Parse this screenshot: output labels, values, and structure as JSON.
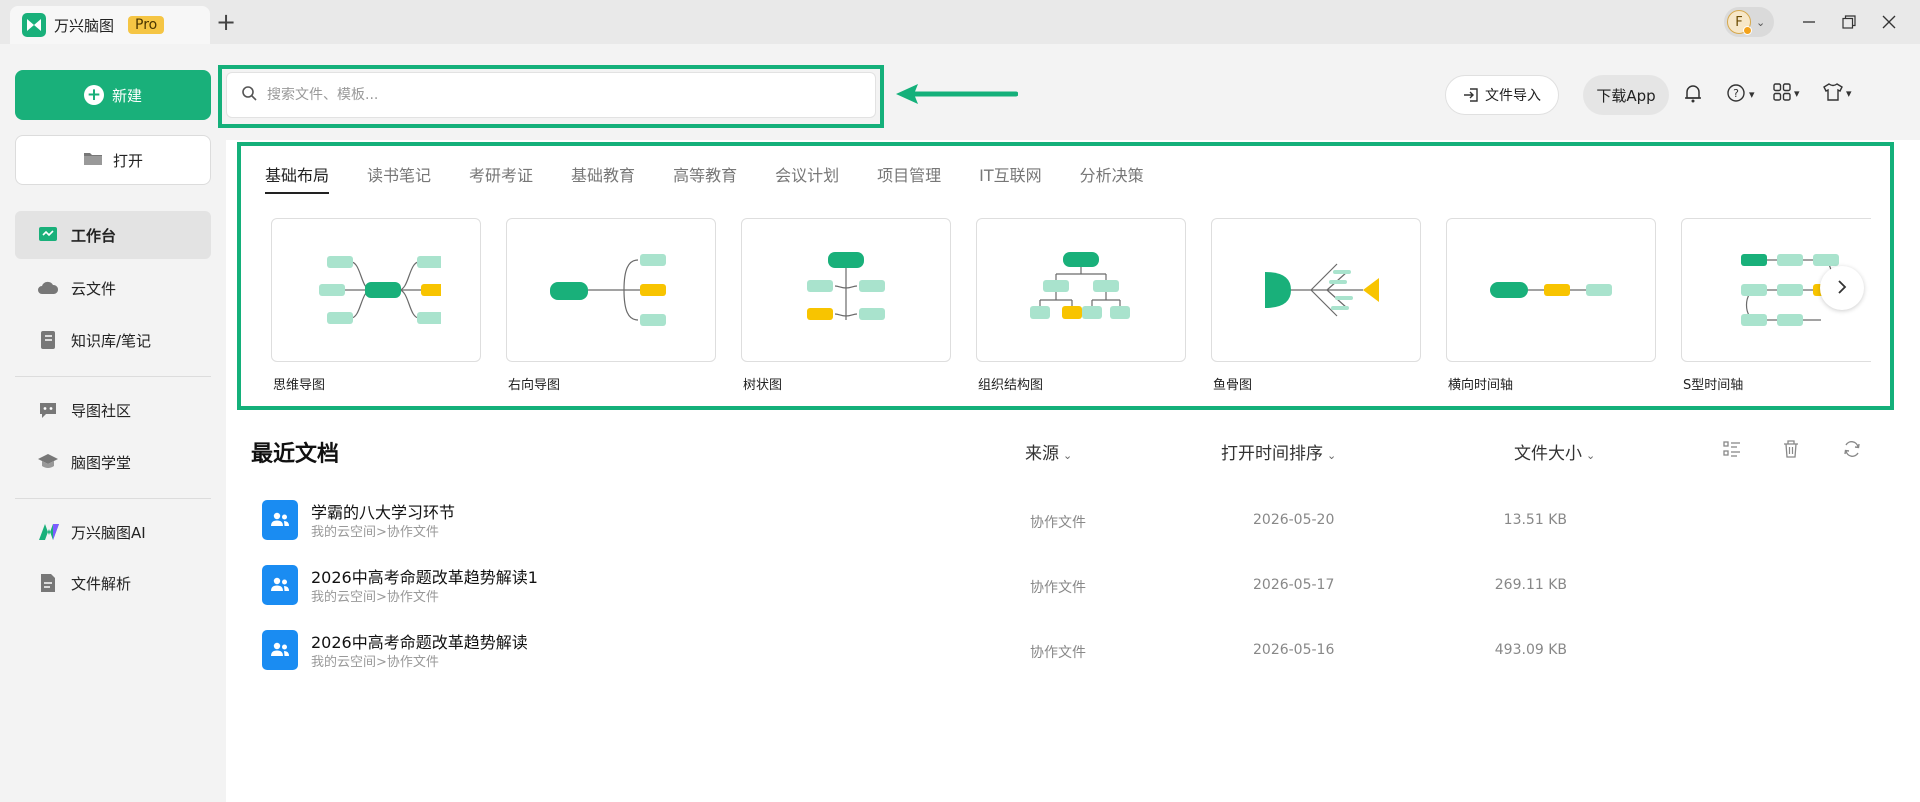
{
  "titlebar": {
    "app_name": "万兴脑图",
    "pro_badge": "Pro",
    "new_tab": "+",
    "avatar_initial": "F",
    "icons": [
      "minimize-icon",
      "restore-icon",
      "close-icon"
    ]
  },
  "sidebar": {
    "new_label": "新建",
    "open_label": "打开",
    "items": [
      {
        "label": "工作台",
        "icon": "workbench-icon",
        "active": true
      },
      {
        "label": "云文件",
        "icon": "cloud-icon"
      },
      {
        "label": "知识库/笔记",
        "icon": "notebook-icon"
      },
      {
        "label": "导图社区",
        "icon": "community-icon"
      },
      {
        "label": "脑图学堂",
        "icon": "academy-icon"
      },
      {
        "label": "万兴脑图AI",
        "icon": "ai-icon"
      },
      {
        "label": "文件解析",
        "icon": "file-parse-icon"
      }
    ]
  },
  "search": {
    "placeholder": "搜索文件、模板..."
  },
  "toolbar": {
    "import_label": "文件导入",
    "download_label": "下载App"
  },
  "templates": {
    "tabs": [
      "基础布局",
      "读书笔记",
      "考研考证",
      "基础教育",
      "高等教育",
      "会议计划",
      "项目管理",
      "IT互联网",
      "分析决策"
    ],
    "active_tab": 0,
    "cards": [
      "思维导图",
      "右向导图",
      "树状图",
      "组织结构图",
      "鱼骨图",
      "横向时间轴",
      "S型时间轴"
    ]
  },
  "recent": {
    "title": "最近文档",
    "col_source": "来源",
    "col_time": "打开时间排序",
    "col_size": "文件大小",
    "rows": [
      {
        "name": "学霸的八大学习环节",
        "path": "我的云空间>协作文件",
        "source": "协作文件",
        "date": "2026-05-20",
        "size": "13.51 KB"
      },
      {
        "name": "2026中高考命题改革趋势解读1",
        "path": "我的云空间>协作文件",
        "source": "协作文件",
        "date": "2026-05-17",
        "size": "269.11 KB"
      },
      {
        "name": "2026中高考命题改革趋势解读",
        "path": "我的云空间>协作文件",
        "source": "协作文件",
        "date": "2026-05-16",
        "size": "493.09 KB"
      }
    ]
  },
  "colors": {
    "accent": "#19b07a",
    "highlight": "#14b07a",
    "file_icon": "#1a8cf2",
    "template_yellow": "#f8c400",
    "template_light": "#a9e3cd"
  }
}
